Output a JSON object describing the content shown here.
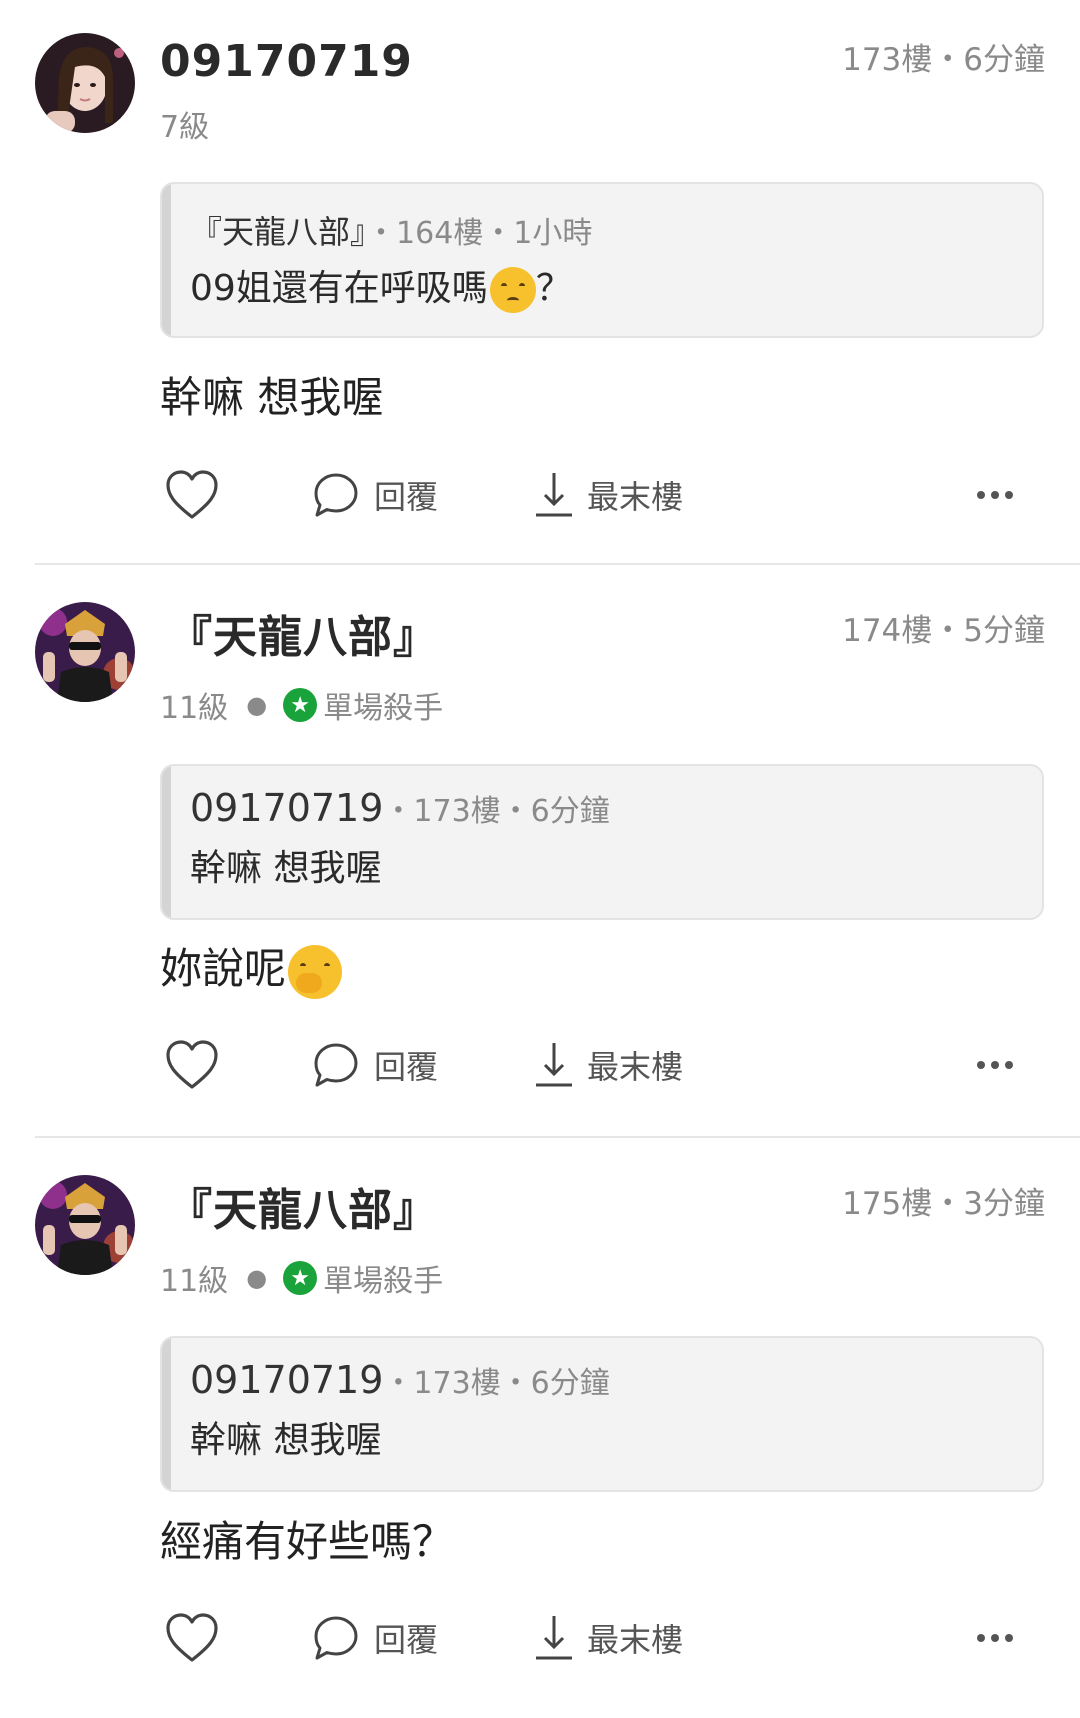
{
  "posts": [
    {
      "username": "09170719",
      "floor_time": "173樓・6分鐘",
      "level": "7級",
      "badge": "",
      "quote": {
        "author": "『天龍八部』",
        "meta": "・164樓・1小時",
        "text": "09姐還有在呼吸嗎",
        "emoji": "face-exhaling",
        "tail": "？"
      },
      "content": "幹嘛 想我喔",
      "content_emoji": ""
    },
    {
      "username": "『天龍八部』",
      "floor_time": "174樓・5分鐘",
      "level": "11級",
      "badge": "單場殺手",
      "quote": {
        "author": "09170719",
        "meta": "・173樓・6分鐘",
        "text": "幹嘛 想我喔",
        "emoji": "",
        "tail": ""
      },
      "content": "妳說呢",
      "content_emoji": "hand-over-mouth"
    },
    {
      "username": "『天龍八部』",
      "floor_time": "175樓・3分鐘",
      "level": "11級",
      "badge": "單場殺手",
      "quote": {
        "author": "09170719",
        "meta": "・173樓・6分鐘",
        "text": "幹嘛 想我喔",
        "emoji": "",
        "tail": ""
      },
      "content": "經痛有好些嗎？",
      "content_emoji": ""
    }
  ],
  "actions": {
    "reply_label": "回覆",
    "last_floor_label": "最末樓"
  },
  "colors": {
    "meta_gray": "#8a8a8a",
    "badge_green": "#19a33a",
    "quote_bg": "#f3f3f3",
    "quote_bar": "#d4d4d4",
    "divider": "#e6e6e6"
  }
}
